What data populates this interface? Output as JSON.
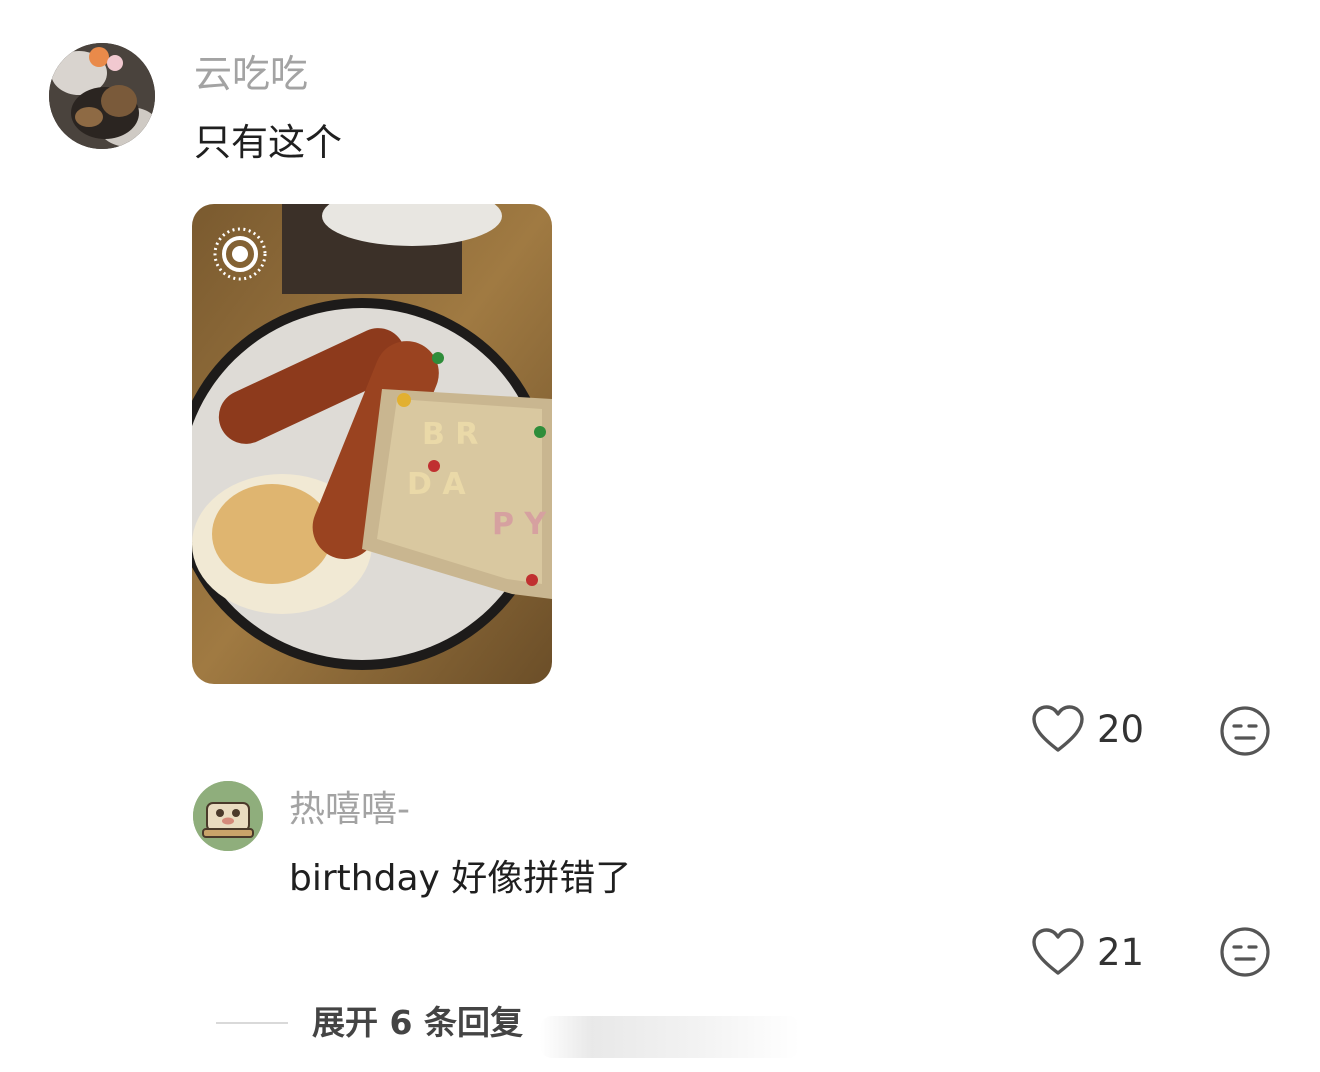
{
  "comment": {
    "username": "云吃吃",
    "text": "只有这个",
    "photo_icon": "live-photo-icon",
    "likes": "20",
    "reply": {
      "username": "热嘻嘻-",
      "text": "birthday 好像拼错了",
      "likes": "21"
    },
    "expand_label": "展开 6 条回复"
  },
  "colors": {
    "username": "#a3a3a3",
    "text": "#1f1f1f",
    "icon": "#555555"
  }
}
